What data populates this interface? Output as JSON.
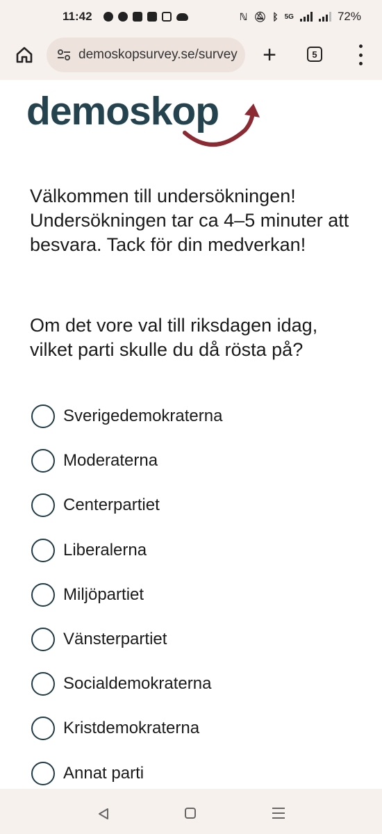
{
  "status_bar": {
    "time": "11:42",
    "left_icons": [
      "signal-app-icon",
      "messenger-icon",
      "stack-icon",
      "linkedin-icon",
      "gmail-icon",
      "cloud-icon"
    ],
    "network": "5G",
    "battery": "72%"
  },
  "browser": {
    "url": "demoskopsurvey.se/survey",
    "tab_count": "5"
  },
  "brand": {
    "logo_text": "demoskop",
    "logo_color": "#24434f",
    "arrow_color": "#8b2a33"
  },
  "survey": {
    "intro": "Välkommen till undersökningen! Undersökningen tar ca 4–5 minuter att besvara. Tack för din medverkan!",
    "question": "Om det vore val till riksdagen idag, vilket parti skulle du då rösta på?",
    "options": [
      "Sverigedemokraterna",
      "Moderaterna",
      "Centerpartiet",
      "Liberalerna",
      "Miljöpartiet",
      "Vänsterpartiet",
      "Socialdemokraterna",
      "Kristdemokraterna",
      "Annat parti"
    ]
  },
  "colors": {
    "radio_border": "#1f3a48",
    "chrome_background": "#f6f1ed",
    "omnibox_background": "#ede3dc"
  }
}
